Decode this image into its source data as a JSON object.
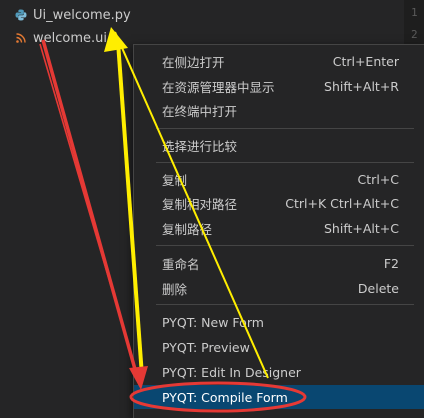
{
  "explorer": {
    "files": [
      {
        "name": "Ui_welcome.py",
        "icon": "python-file-icon"
      },
      {
        "name": "welcome.ui",
        "icon": "rss-file-icon"
      }
    ]
  },
  "editor": {
    "line_numbers": [
      "1",
      "2"
    ]
  },
  "context_menu": {
    "items": [
      {
        "label": "在侧边打开",
        "shortcut": "Ctrl+Enter"
      },
      {
        "label": "在资源管理器中显示",
        "shortcut": "Shift+Alt+R"
      },
      {
        "label": "在终端中打开",
        "shortcut": ""
      },
      {
        "label": "选择进行比较",
        "shortcut": ""
      },
      {
        "label": "复制",
        "shortcut": "Ctrl+C"
      },
      {
        "label": "复制相对路径",
        "shortcut": "Ctrl+K Ctrl+Alt+C"
      },
      {
        "label": "复制路径",
        "shortcut": "Shift+Alt+C"
      },
      {
        "label": "重命名",
        "shortcut": "F2"
      },
      {
        "label": "删除",
        "shortcut": "Delete"
      },
      {
        "label": "PYQT: New Form",
        "shortcut": ""
      },
      {
        "label": "PYQT: Preview",
        "shortcut": ""
      },
      {
        "label": "PYQT: Edit In Designer",
        "shortcut": ""
      },
      {
        "label": "PYQT: Compile Form",
        "shortcut": ""
      }
    ],
    "selected_index": 12
  },
  "colors": {
    "background": "#252526",
    "selection": "#094771",
    "annotation_red": "#e53935",
    "annotation_yellow": "#ffee00",
    "python_icon": "#519aba",
    "rss_icon": "#e37933"
  }
}
